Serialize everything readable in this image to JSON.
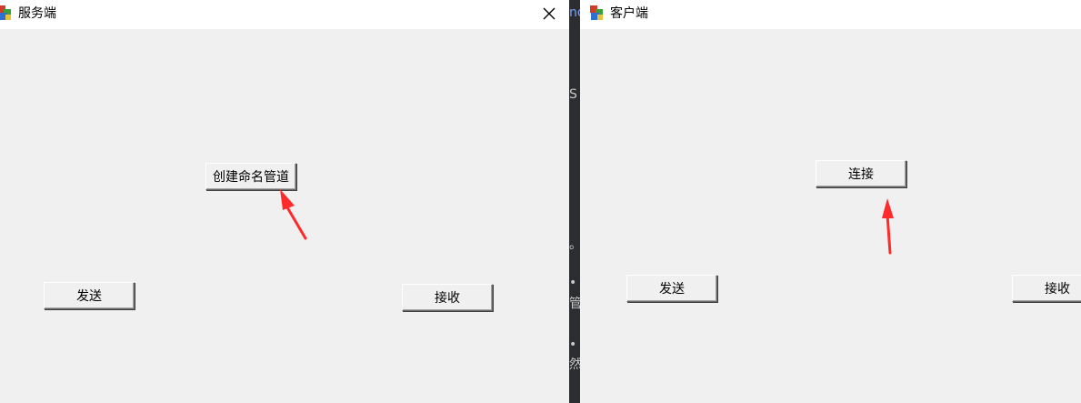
{
  "server_window": {
    "title": "服务端",
    "buttons": {
      "create_pipe": "创建命名管道",
      "send": "发送",
      "receive": "接收"
    }
  },
  "client_window": {
    "title": "客户端",
    "buttons": {
      "connect": "连接",
      "send": "发送",
      "receive": "接收"
    }
  },
  "background_fragments": [
    "no",
    "S",
    "。",
    "• I",
    "管",
    "• I",
    "然"
  ],
  "colors": {
    "window_bg": "#f0f0f0",
    "titlebar_bg": "#ffffff",
    "annotation_arrow": "#ff2b2b",
    "background_app": "#2b2d31"
  }
}
